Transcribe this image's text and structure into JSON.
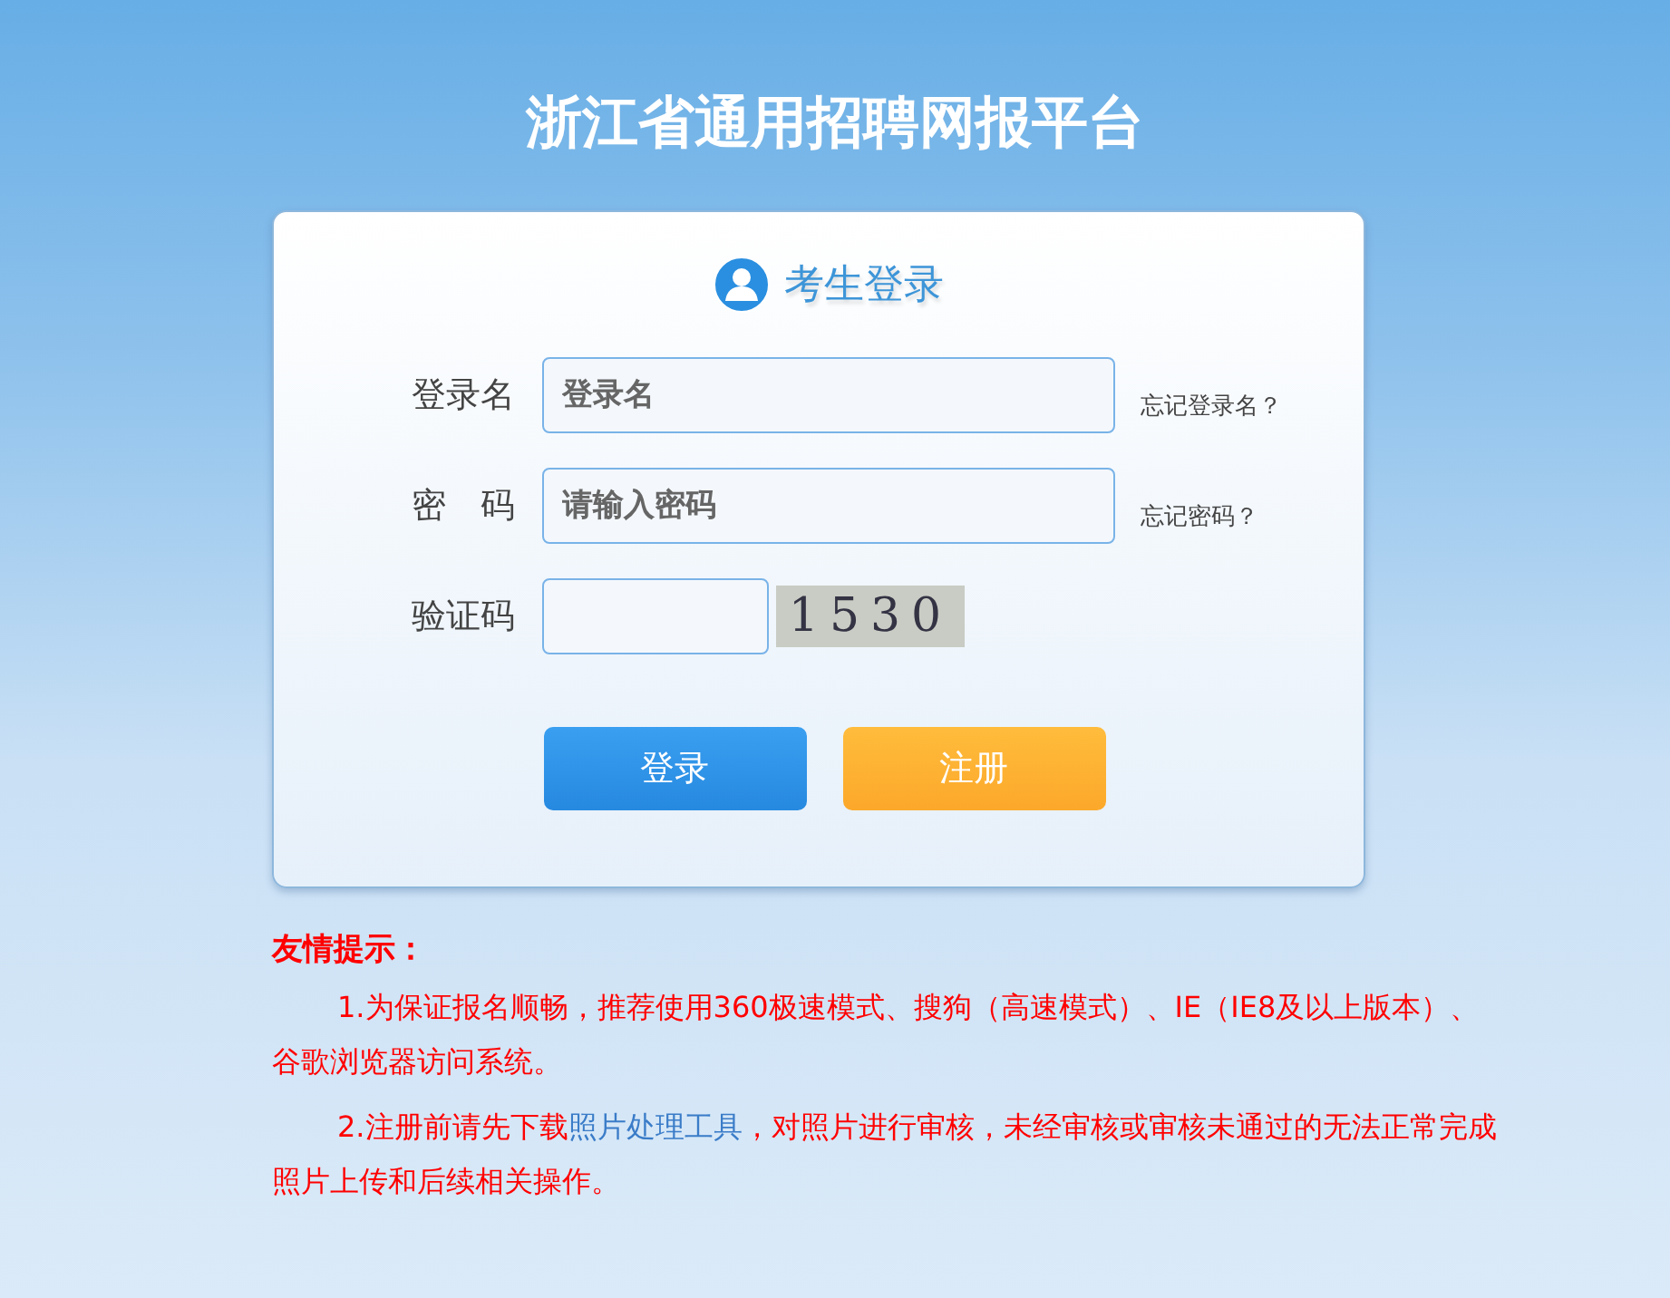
{
  "title": "浙江省通用招聘网报平台",
  "login": {
    "heading": "考生登录",
    "fields": [
      {
        "kind": "text",
        "label": "登录名",
        "placeholder": "登录名",
        "link": "忘记登录名？"
      },
      {
        "kind": "password",
        "label": "密　码",
        "placeholder": "请输入密码",
        "link": "忘记密码？"
      },
      {
        "kind": "captcha",
        "label": "验证码",
        "captcha": "1530"
      }
    ],
    "buttons": [
      {
        "kind": "primary",
        "label": "登录"
      },
      {
        "kind": "warning",
        "label": "注册"
      }
    ]
  },
  "tips": {
    "heading": "友情提示：",
    "items": [
      {
        "before": "1.为保证报名顺畅，推荐使用360极速模式、搜狗（高速模式）、IE（IE8及以上版本）、谷歌浏览器访问系统。"
      },
      {
        "before": "2.注册前请先下载",
        "link": "照片处理工具",
        "after": "，对照片进行审核，未经审核或审核未通过的无法正常完成照片上传和后续相关操作。"
      }
    ]
  }
}
